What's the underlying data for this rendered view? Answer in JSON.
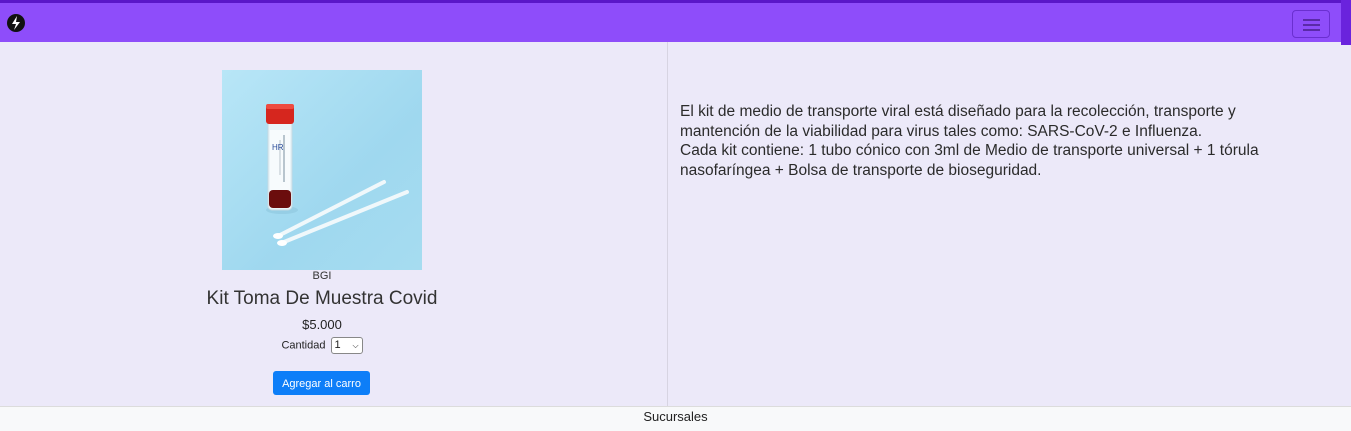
{
  "navbar": {
    "logo_icon": "brand-logo-icon",
    "menu_icon": "hamburger-menu-icon",
    "colors": {
      "background": "#8e4dfa",
      "border": "#5a17c8"
    }
  },
  "product": {
    "image_alt": "",
    "brand": "BGI",
    "title": "Kit Toma De Muestra Covid",
    "price": "$5.000",
    "quantity_label": "Cantidad",
    "quantity_value": "1",
    "add_to_cart_label": "Agregar al carro",
    "button_color": "#0d7ef8"
  },
  "description": {
    "paragraph_1": "El kit de medio de transporte viral está diseñado para la recolección, transporte y mantención de la viabilidad para virus tales como: SARS-CoV-2 e Influenza.",
    "paragraph_2": "Cada kit contiene: 1 tubo cónico con 3ml de Medio de transporte universal + 1 tórula nasofaríngea + Bolsa de transporte de bioseguridad."
  },
  "footer": {
    "label": "Sucursales"
  }
}
